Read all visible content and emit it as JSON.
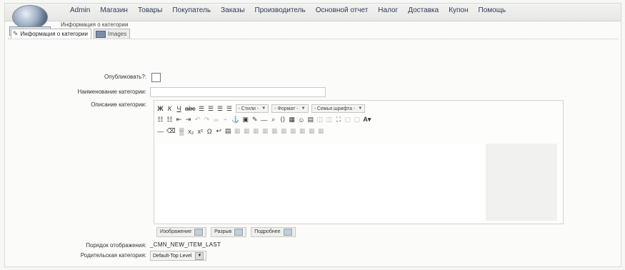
{
  "app": {
    "logo_text": "VirtueMart"
  },
  "menu": {
    "items": [
      "Admin",
      "Магазин",
      "Товары",
      "Покупатель",
      "Заказы",
      "Производитель",
      "Основной отчет",
      "Налог",
      "Доставка",
      "Купон",
      "Помощь"
    ]
  },
  "page": {
    "heading": "Информация о категории"
  },
  "tabs": [
    {
      "label": "Информация о категории"
    },
    {
      "label": "Images"
    }
  ],
  "form": {
    "published_label": "Опубликовать?:",
    "name_label": "Наименование категории:",
    "description_label": "Описание категории:",
    "order_label": "Порядок отображения:",
    "order_value": "_CMN_NEW_ITEM_LAST",
    "parent_label": "Родительская категория:",
    "parent_value": "Default-Top Level"
  },
  "editor": {
    "styles_select": "- Стили -",
    "format_select": "- Формат -",
    "font_select": "- Семья шрифта -"
  },
  "editor_buttons": {
    "image": "Изображение",
    "pagebreak": "Разрыв",
    "readmore": "Подробнее"
  }
}
